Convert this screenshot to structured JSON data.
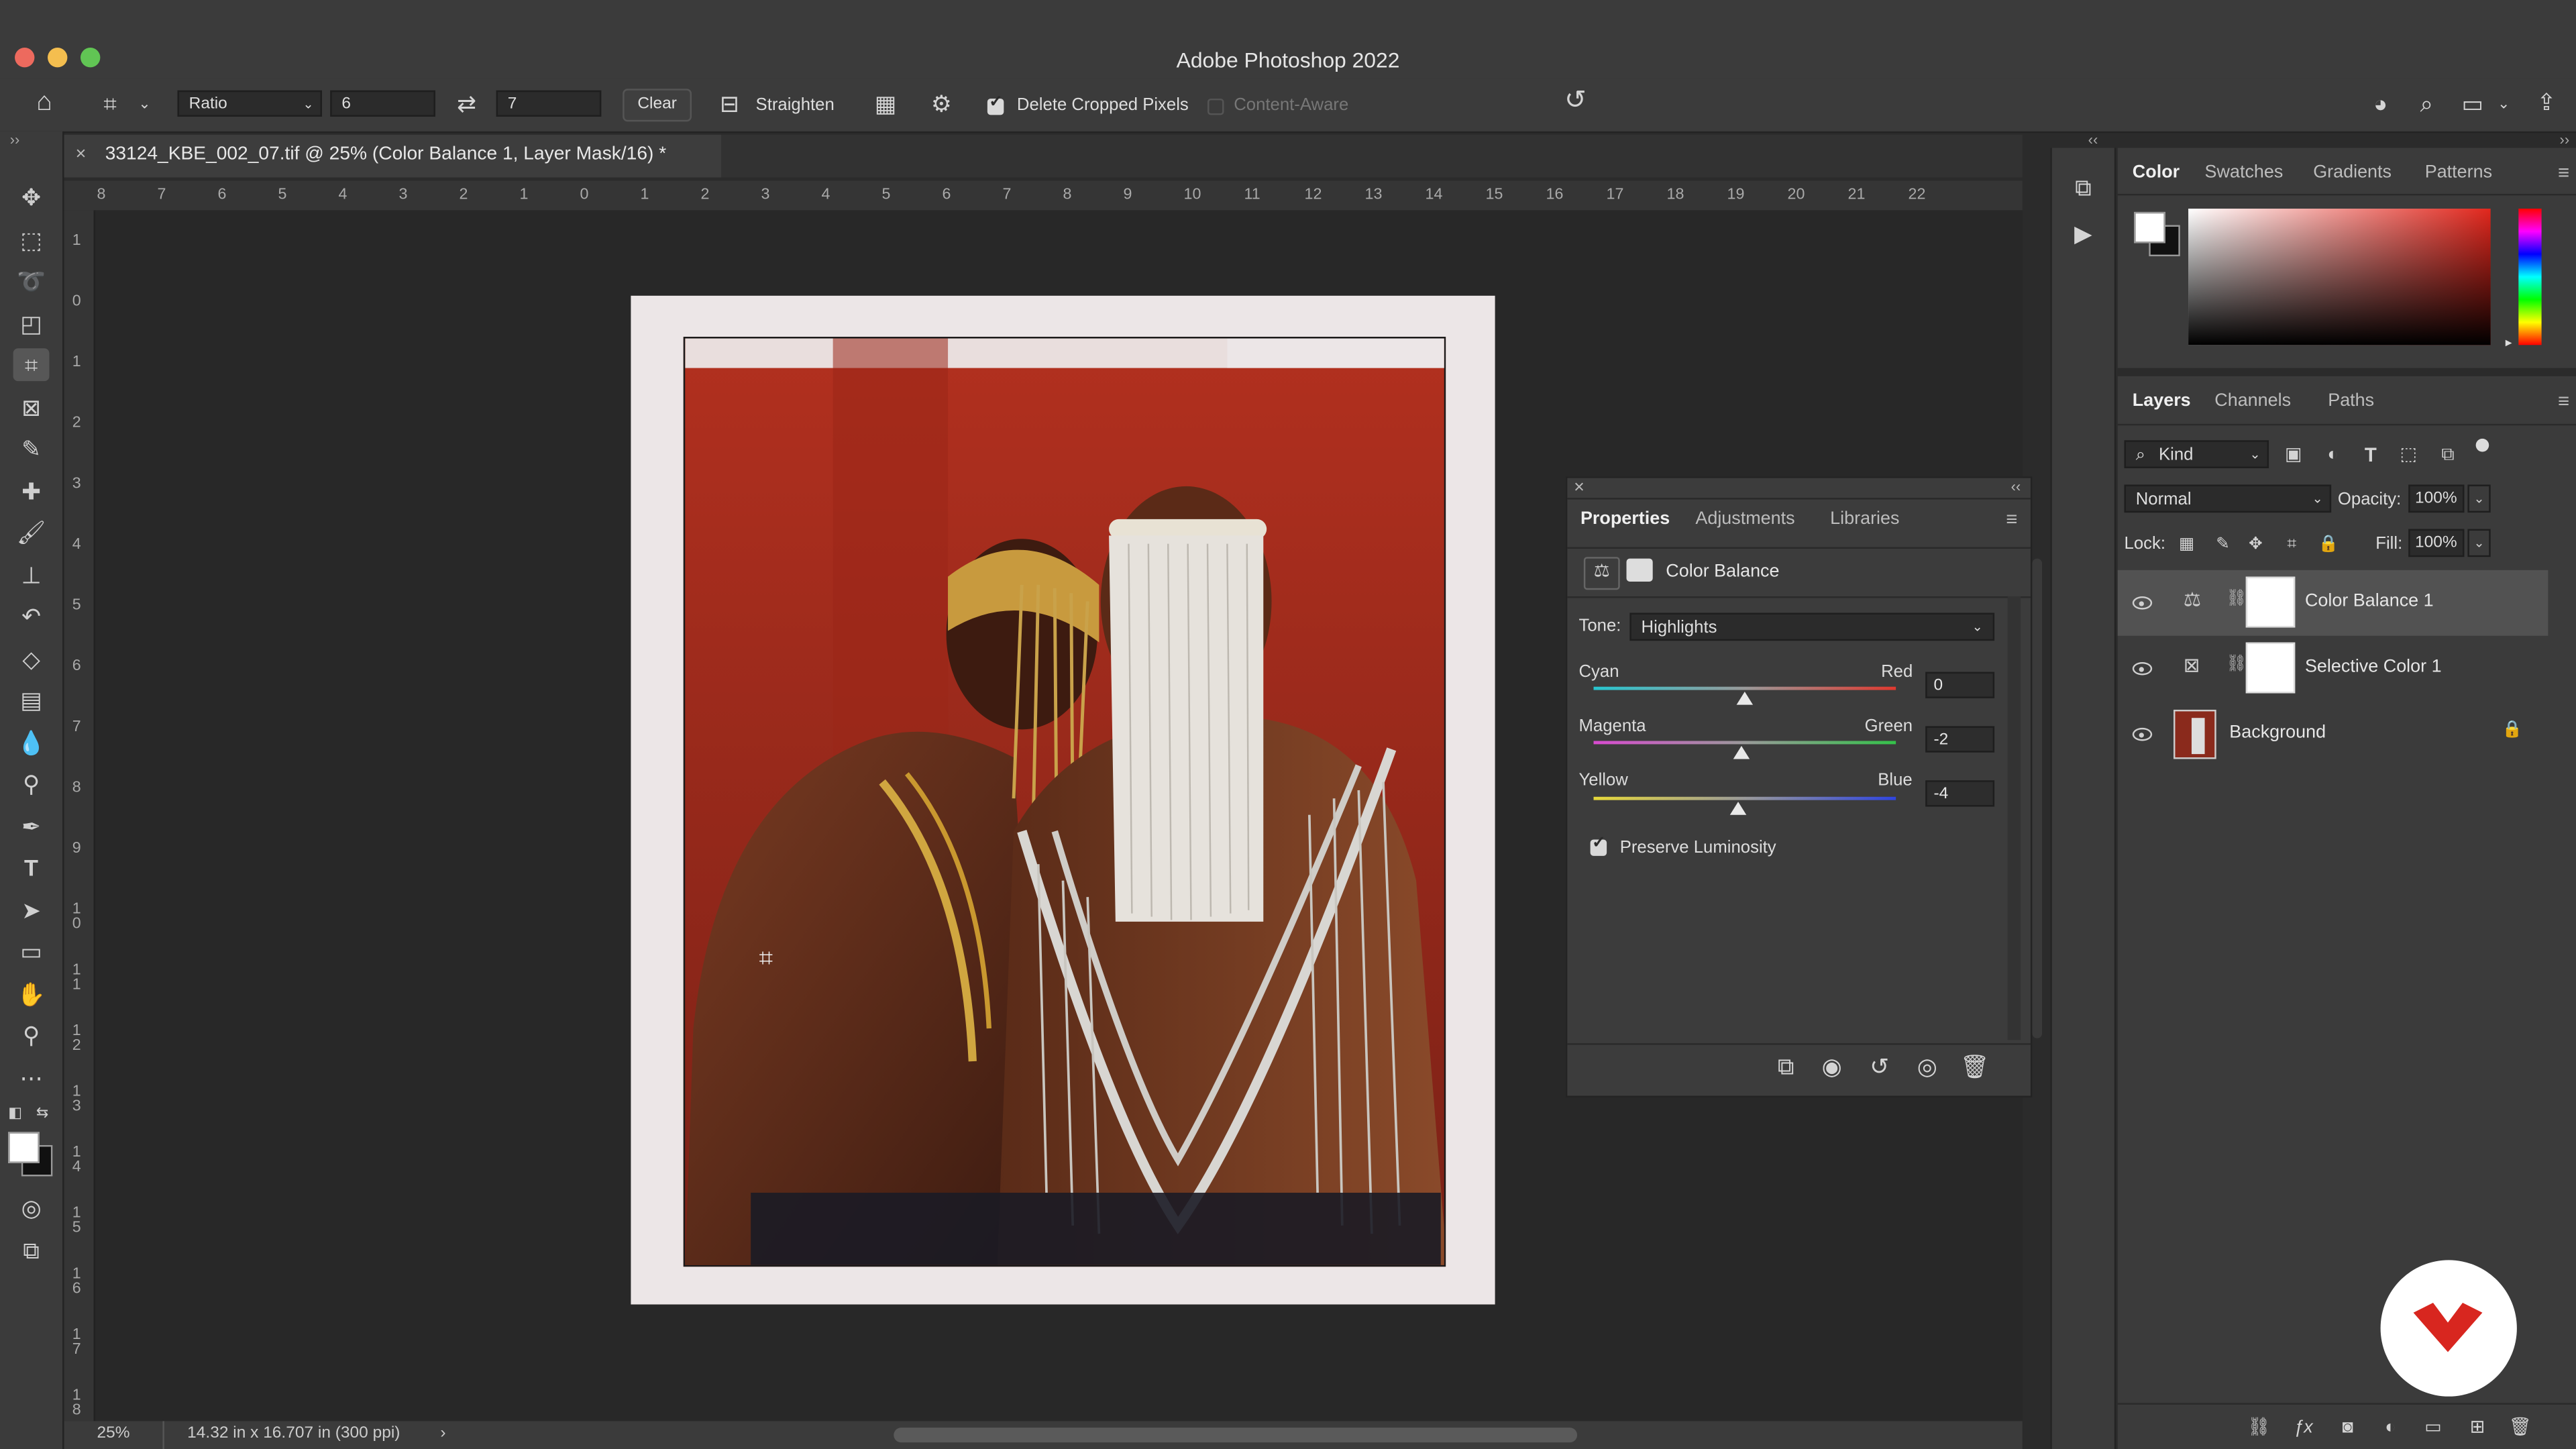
{
  "window": {
    "title": "Adobe Photoshop 2022"
  },
  "options_bar": {
    "ratio_label": "Ratio",
    "width_value": "6",
    "height_value": "7",
    "clear_label": "Clear",
    "straighten_label": "Straighten",
    "delete_cropped_label": "Delete Cropped Pixels",
    "content_aware_label": "Content-Aware",
    "delete_cropped_checked": true
  },
  "document": {
    "tab_title": "33124_KBE_002_07.tif @ 25% (Color Balance 1, Layer Mask/16) *",
    "zoom": "25%",
    "doc_info": "14.32 in x 16.707 in (300 ppi)",
    "h_ruler": [
      "8",
      "7",
      "6",
      "5",
      "4",
      "3",
      "2",
      "1",
      "0",
      "1",
      "2",
      "3",
      "4",
      "5",
      "6",
      "7",
      "8",
      "9",
      "10",
      "11",
      "12",
      "13",
      "14",
      "15",
      "16",
      "17",
      "18",
      "19",
      "20",
      "21",
      "22"
    ],
    "v_ruler": [
      "1",
      "0",
      "1",
      "2",
      "3",
      "4",
      "5",
      "6",
      "7",
      "8",
      "9",
      "1\n0",
      "1\n1",
      "1\n2",
      "1\n3",
      "1\n4",
      "1\n5",
      "1\n6",
      "1\n7",
      "1\n8"
    ]
  },
  "properties_panel": {
    "tabs": [
      "Properties",
      "Adjustments",
      "Libraries"
    ],
    "active_tab": "Properties",
    "heading": "Color Balance",
    "tone_label": "Tone:",
    "tone_value": "Highlights",
    "sliders": [
      {
        "left": "Cyan",
        "right": "Red",
        "value": "0",
        "position": 0.5,
        "colors": [
          "#27c6d0",
          "#e0392f"
        ]
      },
      {
        "left": "Magenta",
        "right": "Green",
        "value": "-2",
        "position": 0.49,
        "colors": [
          "#d84bd0",
          "#34c24a"
        ]
      },
      {
        "left": "Yellow",
        "right": "Blue",
        "value": "-4",
        "position": 0.48,
        "colors": [
          "#e6d83a",
          "#2f45e0"
        ]
      }
    ],
    "preserve_label": "Preserve Luminosity",
    "preserve_checked": true
  },
  "color_panel": {
    "tabs": [
      "Color",
      "Swatches",
      "Gradients",
      "Patterns"
    ],
    "active_tab": "Color",
    "hue_color": "#e1271d"
  },
  "layers_panel": {
    "tabs": [
      "Layers",
      "Channels",
      "Paths"
    ],
    "active_tab": "Layers",
    "filter_label": "Kind",
    "blend_mode": "Normal",
    "opacity_label": "Opacity:",
    "opacity_value": "100%",
    "lock_label": "Lock:",
    "fill_label": "Fill:",
    "fill_value": "100%",
    "layers": [
      {
        "name": "Color Balance 1",
        "type": "adjustment",
        "selected": true
      },
      {
        "name": "Selective Color 1",
        "type": "adjustment",
        "selected": false
      },
      {
        "name": "Background",
        "type": "image",
        "selected": false,
        "locked": true
      }
    ]
  }
}
